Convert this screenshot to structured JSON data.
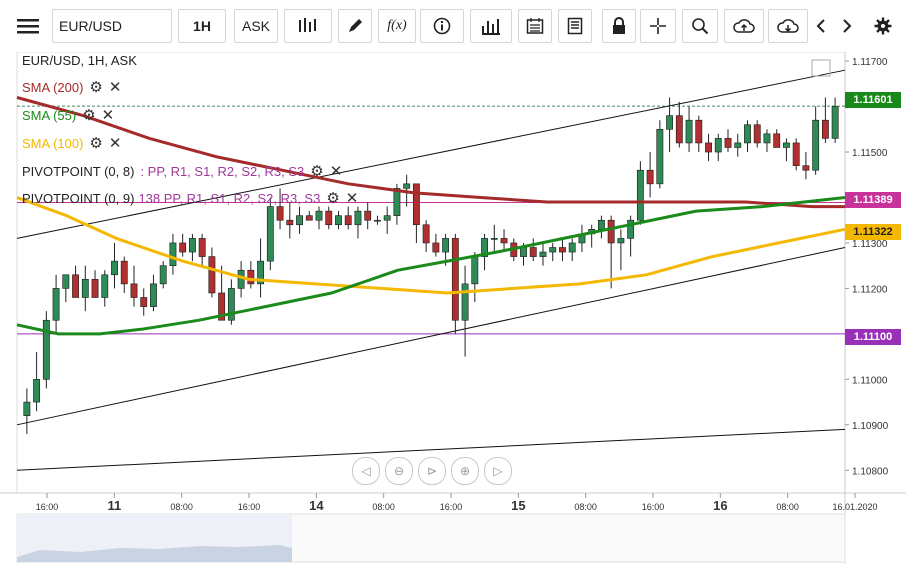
{
  "toolbar": {
    "symbol": "EUR/USD",
    "timeframe": "1H",
    "price_side": "ASK"
  },
  "legend": {
    "title": "EUR/USD, 1H, ASK",
    "items": [
      {
        "label": "SMA (200)",
        "color": "#a52a2a"
      },
      {
        "label": "SMA (55)",
        "color": "#1a8a1a"
      },
      {
        "label": "SMA (100)",
        "color": "#f5b800"
      }
    ],
    "pivots": [
      {
        "prefix": "PIVOTPOINT (0, 8)",
        "tail": ": PP, R1, S1, R2, S2, R3, S3"
      },
      {
        "prefix": "PIVOTPOINT (0, 9)",
        "tail": "138 PP, R1, S1, R2, S2, R3, S3"
      }
    ]
  },
  "price_tags": [
    {
      "value": "1.11601",
      "bg": "#198a19"
    },
    {
      "value": "1.11389",
      "bg": "#c8329b"
    },
    {
      "value": "1.11322",
      "bg": "#f5b800",
      "fg": "#222"
    },
    {
      "value": "1.11100",
      "bg": "#9a2fb8"
    }
  ],
  "chart_data": {
    "type": "candlestick",
    "title": "EUR/USD, 1H, ASK",
    "ylim": [
      1.1075,
      1.1172
    ],
    "y_ticks": [
      "1.11700",
      "1.11500",
      "1.11400",
      "1.11300",
      "1.11200",
      "1.11100",
      "1.11000",
      "1.10900",
      "1.10800"
    ],
    "x_ticks": [
      {
        "label": "16:00",
        "bold": false
      },
      {
        "label": "11",
        "bold": true
      },
      {
        "label": "08:00",
        "bold": false
      },
      {
        "label": "16:00",
        "bold": false
      },
      {
        "label": "14",
        "bold": true
      },
      {
        "label": "08:00",
        "bold": false
      },
      {
        "label": "16:00",
        "bold": false
      },
      {
        "label": "15",
        "bold": true
      },
      {
        "label": "08:00",
        "bold": false
      },
      {
        "label": "16:00",
        "bold": false
      },
      {
        "label": "16",
        "bold": true
      },
      {
        "label": "08:00",
        "bold": false
      },
      {
        "label": "16.01.2020",
        "bold": false
      }
    ],
    "colors": {
      "up": "#2e8b57",
      "down": "#b03030"
    },
    "candles": [
      [
        1.1092,
        1.1098,
        1.1088,
        1.1095
      ],
      [
        1.1095,
        1.1106,
        1.1093,
        1.11
      ],
      [
        1.11,
        1.1115,
        1.1098,
        1.1113
      ],
      [
        1.1113,
        1.1123,
        1.111,
        1.112
      ],
      [
        1.112,
        1.1123,
        1.1117,
        1.1123
      ],
      [
        1.1123,
        1.1125,
        1.1118,
        1.1118
      ],
      [
        1.1118,
        1.1125,
        1.1115,
        1.1122
      ],
      [
        1.1122,
        1.1124,
        1.1118,
        1.1118
      ],
      [
        1.1118,
        1.1124,
        1.1116,
        1.1123
      ],
      [
        1.1123,
        1.113,
        1.112,
        1.1126
      ],
      [
        1.1126,
        1.1127,
        1.1119,
        1.1121
      ],
      [
        1.1121,
        1.1125,
        1.1116,
        1.1118
      ],
      [
        1.1118,
        1.112,
        1.1114,
        1.1116
      ],
      [
        1.1116,
        1.1123,
        1.1115,
        1.1121
      ],
      [
        1.1121,
        1.1126,
        1.112,
        1.1125
      ],
      [
        1.1125,
        1.1132,
        1.1123,
        1.113
      ],
      [
        1.113,
        1.1132,
        1.1127,
        1.1128
      ],
      [
        1.1128,
        1.1132,
        1.1126,
        1.1131
      ],
      [
        1.1131,
        1.1132,
        1.1125,
        1.1127
      ],
      [
        1.1127,
        1.1129,
        1.1118,
        1.1119
      ],
      [
        1.1119,
        1.1125,
        1.1113,
        1.1113
      ],
      [
        1.1113,
        1.1122,
        1.1112,
        1.112
      ],
      [
        1.112,
        1.1126,
        1.1118,
        1.1124
      ],
      [
        1.1124,
        1.1126,
        1.112,
        1.1121
      ],
      [
        1.1121,
        1.1131,
        1.1118,
        1.1126
      ],
      [
        1.1126,
        1.114,
        1.1124,
        1.1138
      ],
      [
        1.1138,
        1.1142,
        1.1133,
        1.1135
      ],
      [
        1.1135,
        1.1139,
        1.1131,
        1.1134
      ],
      [
        1.1134,
        1.1138,
        1.1132,
        1.1136
      ],
      [
        1.1136,
        1.1137,
        1.1135,
        1.1135
      ],
      [
        1.1135,
        1.1138,
        1.1133,
        1.1137
      ],
      [
        1.1137,
        1.1138,
        1.1133,
        1.1134
      ],
      [
        1.1134,
        1.1137,
        1.1133,
        1.1136
      ],
      [
        1.1136,
        1.1138,
        1.1133,
        1.1134
      ],
      [
        1.1134,
        1.1138,
        1.1131,
        1.1137
      ],
      [
        1.1137,
        1.1139,
        1.1133,
        1.1135
      ],
      [
        1.1135,
        1.1136,
        1.1134,
        1.1135
      ],
      [
        1.1135,
        1.1138,
        1.1132,
        1.1136
      ],
      [
        1.1136,
        1.1143,
        1.1134,
        1.1142
      ],
      [
        1.1142,
        1.1145,
        1.1138,
        1.1143
      ],
      [
        1.1143,
        1.1143,
        1.113,
        1.1134
      ],
      [
        1.1134,
        1.1135,
        1.1128,
        1.113
      ],
      [
        1.113,
        1.1132,
        1.1127,
        1.1128
      ],
      [
        1.1128,
        1.1132,
        1.1125,
        1.1131
      ],
      [
        1.1131,
        1.1132,
        1.111,
        1.1113
      ],
      [
        1.1113,
        1.1125,
        1.1105,
        1.1121
      ],
      [
        1.1121,
        1.1128,
        1.1117,
        1.1127
      ],
      [
        1.1127,
        1.1132,
        1.1124,
        1.1131
      ],
      [
        1.1131,
        1.1134,
        1.1128,
        1.1131
      ],
      [
        1.1131,
        1.1133,
        1.1128,
        1.113
      ],
      [
        1.113,
        1.1131,
        1.1126,
        1.1127
      ],
      [
        1.1127,
        1.113,
        1.1125,
        1.1129
      ],
      [
        1.1129,
        1.1131,
        1.1126,
        1.1127
      ],
      [
        1.1127,
        1.113,
        1.1125,
        1.1128
      ],
      [
        1.1128,
        1.113,
        1.1126,
        1.1129
      ],
      [
        1.1129,
        1.1131,
        1.1126,
        1.1128
      ],
      [
        1.1128,
        1.1131,
        1.1126,
        1.113
      ],
      [
        1.113,
        1.1134,
        1.1128,
        1.1132
      ],
      [
        1.1132,
        1.1134,
        1.1129,
        1.1133
      ],
      [
        1.1133,
        1.1136,
        1.1131,
        1.1135
      ],
      [
        1.1135,
        1.1136,
        1.112,
        1.113
      ],
      [
        1.113,
        1.1133,
        1.1124,
        1.1131
      ],
      [
        1.1131,
        1.1136,
        1.1127,
        1.1135
      ],
      [
        1.1135,
        1.1148,
        1.1134,
        1.1146
      ],
      [
        1.1146,
        1.115,
        1.114,
        1.1143
      ],
      [
        1.1143,
        1.1157,
        1.1142,
        1.1155
      ],
      [
        1.1155,
        1.1162,
        1.115,
        1.1158
      ],
      [
        1.1158,
        1.1161,
        1.1151,
        1.1152
      ],
      [
        1.1152,
        1.116,
        1.115,
        1.1157
      ],
      [
        1.1157,
        1.1158,
        1.115,
        1.1152
      ],
      [
        1.1152,
        1.1154,
        1.1148,
        1.115
      ],
      [
        1.115,
        1.1154,
        1.1148,
        1.1153
      ],
      [
        1.1153,
        1.1155,
        1.115,
        1.1151
      ],
      [
        1.1151,
        1.1154,
        1.1149,
        1.1152
      ],
      [
        1.1152,
        1.1157,
        1.115,
        1.1156
      ],
      [
        1.1156,
        1.1157,
        1.1151,
        1.1152
      ],
      [
        1.1152,
        1.1155,
        1.115,
        1.1154
      ],
      [
        1.1154,
        1.1155,
        1.1151,
        1.1151
      ],
      [
        1.1151,
        1.1153,
        1.1148,
        1.1152
      ],
      [
        1.1152,
        1.1153,
        1.1146,
        1.1147
      ],
      [
        1.1147,
        1.115,
        1.1144,
        1.1146
      ],
      [
        1.1146,
        1.116,
        1.1145,
        1.1157
      ],
      [
        1.1157,
        1.1162,
        1.1152,
        1.1153
      ],
      [
        1.1153,
        1.1162,
        1.1152,
        1.116
      ]
    ],
    "sma200": [
      [
        0,
        1.1162
      ],
      [
        0.08,
        1.1158
      ],
      [
        0.16,
        1.1153
      ],
      [
        0.24,
        1.1149
      ],
      [
        0.32,
        1.1146
      ],
      [
        0.4,
        1.1143
      ],
      [
        0.48,
        1.1141
      ],
      [
        0.56,
        1.114
      ],
      [
        0.64,
        1.1139
      ],
      [
        0.72,
        1.1139
      ],
      [
        0.8,
        1.1139
      ],
      [
        0.88,
        1.1139
      ],
      [
        0.96,
        1.1138
      ],
      [
        1.0,
        1.1138
      ]
    ],
    "sma55": [
      [
        0,
        1.1112
      ],
      [
        0.05,
        1.111
      ],
      [
        0.1,
        1.111
      ],
      [
        0.15,
        1.1111
      ],
      [
        0.22,
        1.1113
      ],
      [
        0.3,
        1.1116
      ],
      [
        0.38,
        1.1119
      ],
      [
        0.46,
        1.1124
      ],
      [
        0.52,
        1.1126
      ],
      [
        0.58,
        1.1128
      ],
      [
        0.66,
        1.1131
      ],
      [
        0.74,
        1.1134
      ],
      [
        0.82,
        1.1137
      ],
      [
        0.9,
        1.1138
      ],
      [
        1.0,
        1.114
      ]
    ],
    "sma100": [
      [
        0,
        1.114
      ],
      [
        0.06,
        1.1136
      ],
      [
        0.12,
        1.1131
      ],
      [
        0.2,
        1.1126
      ],
      [
        0.28,
        1.1122
      ],
      [
        0.36,
        1.1121
      ],
      [
        0.44,
        1.112
      ],
      [
        0.52,
        1.1119
      ],
      [
        0.6,
        1.112
      ],
      [
        0.68,
        1.1121
      ],
      [
        0.76,
        1.1123
      ],
      [
        0.84,
        1.1127
      ],
      [
        0.92,
        1.113
      ],
      [
        1.0,
        1.1133
      ]
    ],
    "pivot_levels": [
      1.11389,
      1.111
    ],
    "last_price": 1.11601,
    "trend_lines": [
      {
        "from": [
          0,
          1.1131
        ],
        "to": [
          1,
          1.1168
        ]
      },
      {
        "from": [
          0,
          1.109
        ],
        "to": [
          1,
          1.1129
        ]
      },
      {
        "from": [
          0,
          1.108
        ],
        "to": [
          1,
          1.1089
        ]
      }
    ]
  }
}
